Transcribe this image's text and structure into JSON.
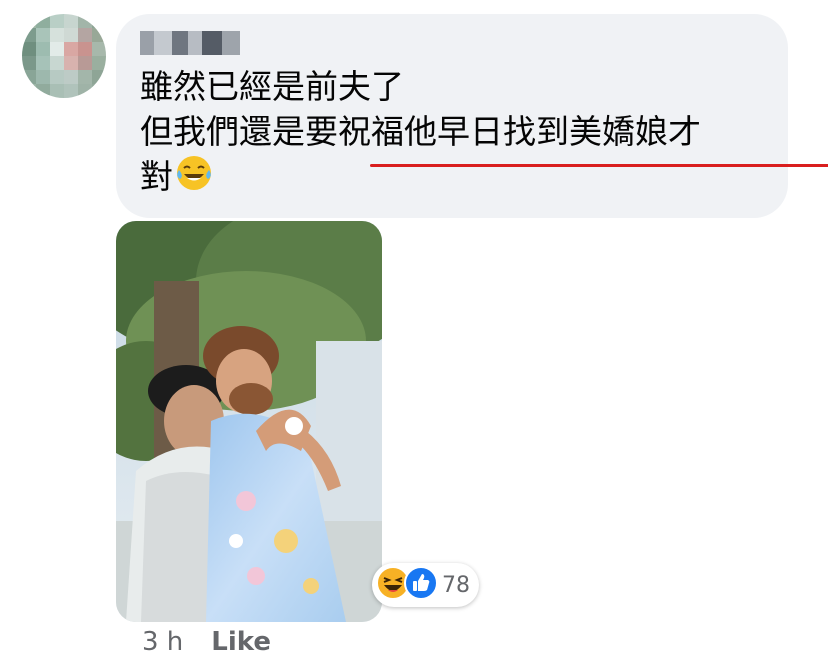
{
  "comment": {
    "text_line1": "雖然已經是前夫了",
    "text_line2": "但我們還是要祝福他早日找到美嬌娘才",
    "text_line3": "對",
    "inline_emoji": "laughing-tears-emoji"
  },
  "reactions": {
    "icons": [
      "haha-reaction-icon",
      "like-reaction-icon"
    ],
    "count": "78",
    "like_color": "#1877f2",
    "haha_color": "#f7b125"
  },
  "meta": {
    "time": "3 h",
    "like_label": "Like"
  },
  "colors": {
    "bubble_bg": "#f0f2f5",
    "text": "#050505",
    "secondary_text": "#65676b",
    "underline": "#d91e1e"
  }
}
